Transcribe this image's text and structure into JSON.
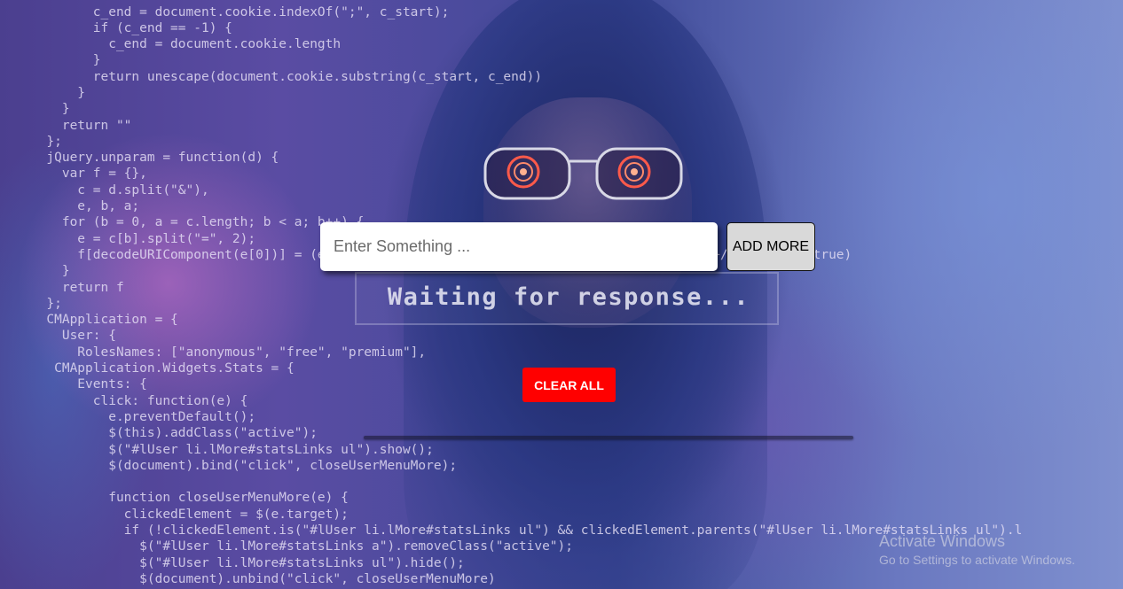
{
  "input": {
    "placeholder": "Enter Something ...",
    "value": ""
  },
  "buttons": {
    "add_more": "ADD MORE",
    "clear_all": "CLEAR ALL"
  },
  "status": {
    "text": "Waiting for response..."
  },
  "colors": {
    "clear_button": "#ff0000",
    "add_button": "#d9d9d9",
    "input_background": "#ffffff"
  },
  "background": {
    "code_lines": [
      "            c_end = document.cookie.indexOf(\";\", c_start);",
      "            if (c_end == -1) {",
      "              c_end = document.cookie.length",
      "            }",
      "            return unescape(document.cookie.substring(c_start, c_end))",
      "          }",
      "        }",
      "        return \"\"",
      "      };",
      "      jQuery.unparam = function(d) {",
      "        var f = {},",
      "          c = d.split(\"&\"),",
      "          e, b, a;",
      "        for (b = 0, a = c.length; b < a; b++) {",
      "          e = c[b].split(\"=\", 2);",
      "          f[decodeURIComponent(e[0])] = (e.length == 2) ? decodeURIComponent(e[1].replace(/\\+/g, \" \")) : true)",
      "        }",
      "        return f",
      "      };",
      "      CMApplication = {",
      "        User: {",
      "          RolesNames: [\"anonymous\", \"free\", \"premium\"],",
      "       CMApplication.Widgets.Stats = {",
      "          Events: {",
      "            click: function(e) {",
      "              e.preventDefault();",
      "              $(this).addClass(\"active\");",
      "              $(\"#lUser li.lMore#statsLinks ul\").show();",
      "              $(document).bind(\"click\", closeUserMenuMore);",
      "",
      "              function closeUserMenuMore(e) {",
      "                clickedElement = $(e.target);",
      "                if (!clickedElement.is(\"#lUser li.lMore#statsLinks ul\") && clickedElement.parents(\"#lUser li.lMore#statsLinks ul\").l",
      "                  $(\"#lUser li.lMore#statsLinks a\").removeClass(\"active\");",
      "                  $(\"#lUser li.lMore#statsLinks ul\").hide();",
      "                  $(document).unbind(\"click\", closeUserMenuMore)"
    ]
  },
  "watermark": {
    "title": "Activate Windows",
    "subtitle": "Go to Settings to activate Windows."
  }
}
